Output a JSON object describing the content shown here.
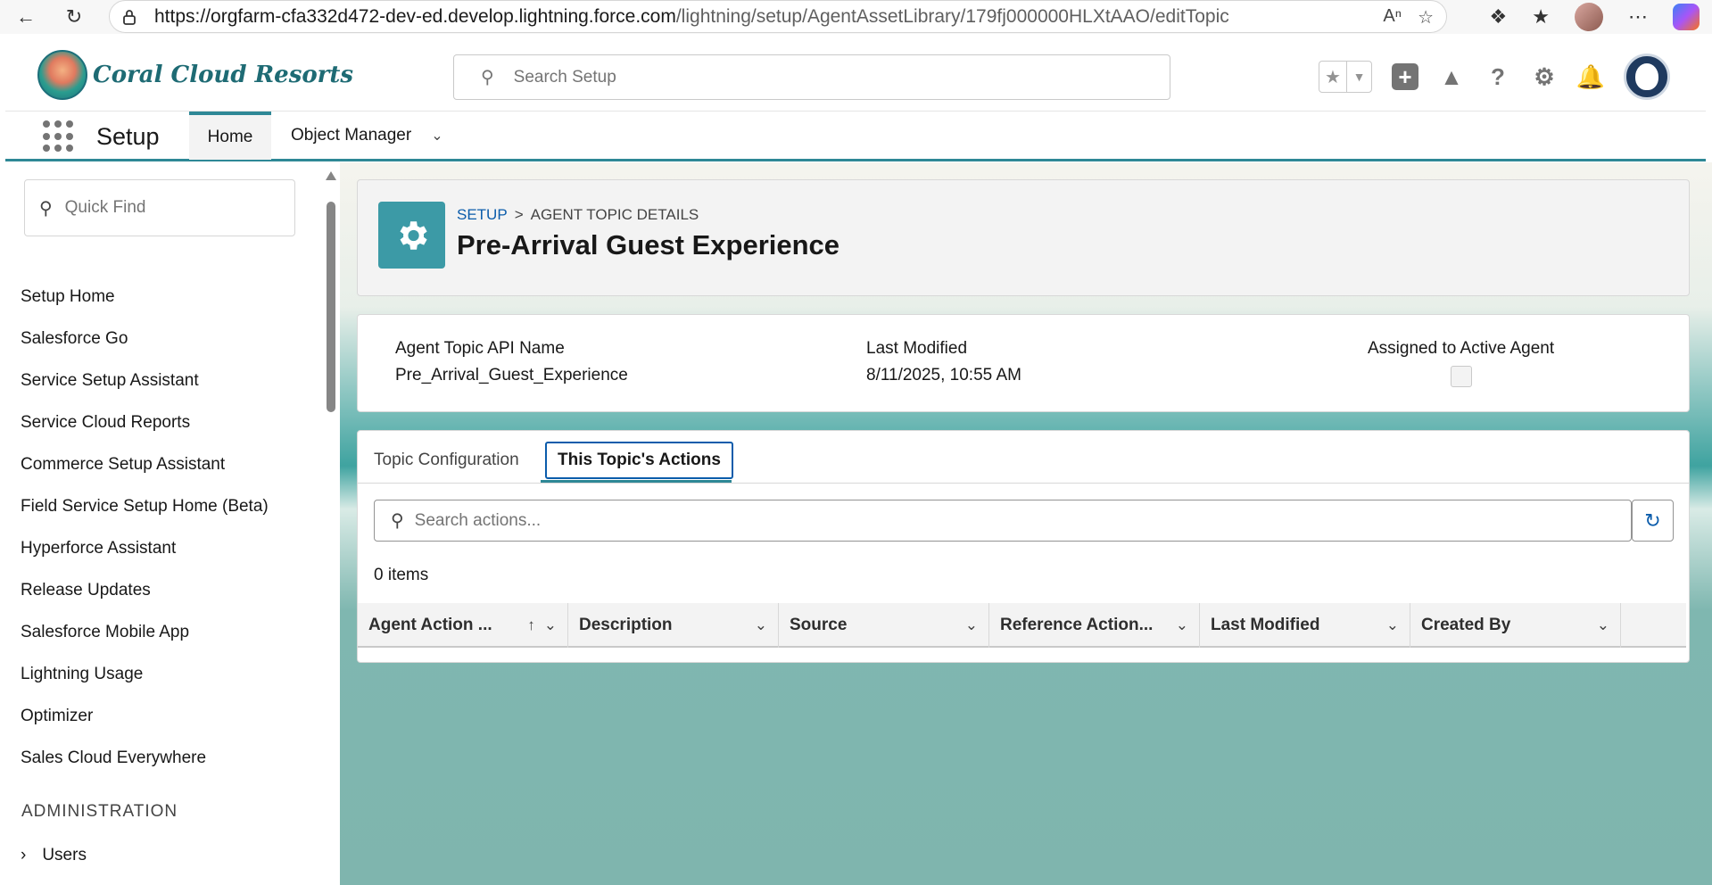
{
  "browser": {
    "url_host": "https://orgfarm-cfa332d472-dev-ed.develop.lightning.force.com",
    "url_path": "/lightning/setup/AgentAssetLibrary/179fj000000HLXtAAO/editTopic"
  },
  "header": {
    "brand": "Coral Cloud Resorts",
    "search_placeholder": "Search Setup"
  },
  "app_nav": {
    "app_name": "Setup",
    "tabs": [
      {
        "label": "Home"
      },
      {
        "label": "Object Manager"
      }
    ]
  },
  "sidebar": {
    "quickfind_placeholder": "Quick Find",
    "items": [
      {
        "label": "Setup Home"
      },
      {
        "label": "Salesforce Go"
      },
      {
        "label": "Service Setup Assistant"
      },
      {
        "label": "Service Cloud Reports"
      },
      {
        "label": "Commerce Setup Assistant"
      },
      {
        "label": "Field Service Setup Home (Beta)"
      },
      {
        "label": "Hyperforce Assistant"
      },
      {
        "label": "Release Updates"
      },
      {
        "label": "Salesforce Mobile App"
      },
      {
        "label": "Lightning Usage"
      },
      {
        "label": "Optimizer"
      },
      {
        "label": "Sales Cloud Everywhere"
      }
    ],
    "section_title": "ADMINISTRATION",
    "section_items": [
      {
        "label": "Users"
      }
    ]
  },
  "page": {
    "breadcrumb_root": "SETUP",
    "breadcrumb_sep": ">",
    "breadcrumb_current": "AGENT TOPIC DETAILS",
    "title": "Pre-Arrival Guest Experience"
  },
  "highlights": {
    "api_name_label": "Agent Topic API Name",
    "api_name_value": "Pre_Arrival_Guest_Experience",
    "last_modified_label": "Last Modified",
    "last_modified_value": "8/11/2025, 10:55 AM",
    "assigned_label": "Assigned to Active Agent",
    "assigned_checked": false
  },
  "tabs": {
    "items": [
      {
        "label": "Topic Configuration"
      },
      {
        "label": "This Topic's Actions"
      }
    ],
    "active": "This Topic's Actions"
  },
  "actions": {
    "search_placeholder": "Search actions...",
    "count": "0 items",
    "columns": [
      {
        "label": "Agent Action ...",
        "sorted": "asc"
      },
      {
        "label": "Description"
      },
      {
        "label": "Source"
      },
      {
        "label": "Reference Action..."
      },
      {
        "label": "Last Modified"
      },
      {
        "label": "Created By"
      }
    ],
    "rows": []
  },
  "colors": {
    "brand_teal": "#2e8896",
    "link_blue": "#0b5cab",
    "header_icon_bg": "#3c9aa6"
  }
}
